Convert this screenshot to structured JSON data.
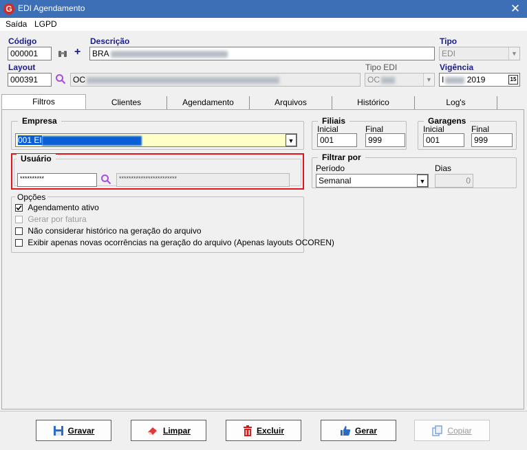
{
  "window": {
    "title": "EDI Agendamento",
    "app_icon_glyph": "G",
    "close": "✕"
  },
  "menu": [
    "Saída",
    "LGPD"
  ],
  "fields": {
    "codigo_label": "Código",
    "codigo_value": "000001",
    "descricao_label": "Descrição",
    "descricao_value": "BRA",
    "tipo_label": "Tipo",
    "tipo_value": "EDI",
    "layout_label": "Layout",
    "layout_value": "000391",
    "layout_desc": "OC",
    "tipo_edi_label": "Tipo EDI",
    "tipo_edi_value": "OC",
    "vigencia_label": "Vigência",
    "vigencia_value": "2019",
    "vigencia_prefix": "I",
    "calendar_glyph": "15"
  },
  "tabs": [
    "Filtros",
    "Clientes",
    "Agendamento",
    "Arquivos",
    "Histórico",
    "Log's"
  ],
  "empresa": {
    "title": "Empresa",
    "value": "001 EI"
  },
  "usuario": {
    "title": "Usuário",
    "code": "**********",
    "name": "************************"
  },
  "filiais": {
    "title": "Filiais",
    "inicial_label": "Inicial",
    "final_label": "Final",
    "inicial": "001",
    "final": "999"
  },
  "garagens": {
    "title": "Garagens",
    "inicial_label": "Inicial",
    "final_label": "Final",
    "inicial": "001",
    "final": "999"
  },
  "filtrar": {
    "title": "Filtrar por",
    "periodo_label": "Período",
    "periodo_value": "Semanal",
    "dias_label": "Dias",
    "dias_value": "0"
  },
  "opcoes": {
    "title": "Opções",
    "items": [
      {
        "label": "Agendamento ativo",
        "checked": true,
        "enabled": true
      },
      {
        "label": "Gerar por fatura",
        "checked": false,
        "enabled": false
      },
      {
        "label": "Não considerar histórico na geração do arquivo",
        "checked": false,
        "enabled": true
      },
      {
        "label": "Exibir apenas novas ocorrências na geração do arquivo (Apenas layouts OCOREN)",
        "checked": false,
        "enabled": true
      }
    ]
  },
  "buttons": {
    "gravar": "Gravar",
    "limpar": "Limpar",
    "excluir": "Excluir",
    "gerar": "Gerar",
    "copiar": "Copiar"
  },
  "colors": {
    "titlebar": "#3c6fb5",
    "label_blue": "#1b1b8a",
    "highlight_red": "#e0141a",
    "empresa_bg": "#ffffc8",
    "selection": "#0a5fd6"
  }
}
